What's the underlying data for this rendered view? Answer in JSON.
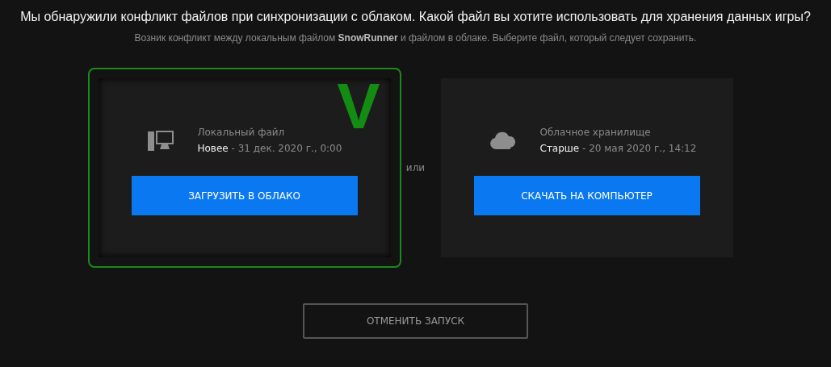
{
  "heading": "Мы обнаружили конфликт файлов при синхронизации с облаком. Какой файл вы хотите использовать для хранения данных игры?",
  "subheading": "Возник конфликт между локальным файлом **SnowRunner** и файлом в облаке. Выберите файл, который следует сохранить.",
  "options": [
    {
      "kind": "local",
      "selected": true,
      "mark": "V",
      "label": "Локальный файл",
      "age": "Новее",
      "date": " - 31 дек. 2020 г., 0:00",
      "button": "ЗАГРУЗИТЬ В ОБЛАКО"
    },
    {
      "kind": "cloud",
      "selected": false,
      "label": "Облачное хранилище",
      "age": "Старше",
      "date": " - 20 мая 2020 г., 14:12",
      "button": "СКАЧАТЬ НА КОМПЬЮТЕР"
    }
  ],
  "separator": "или",
  "cancel_button": "ОТМЕНИТЬ ЗАПУСК"
}
